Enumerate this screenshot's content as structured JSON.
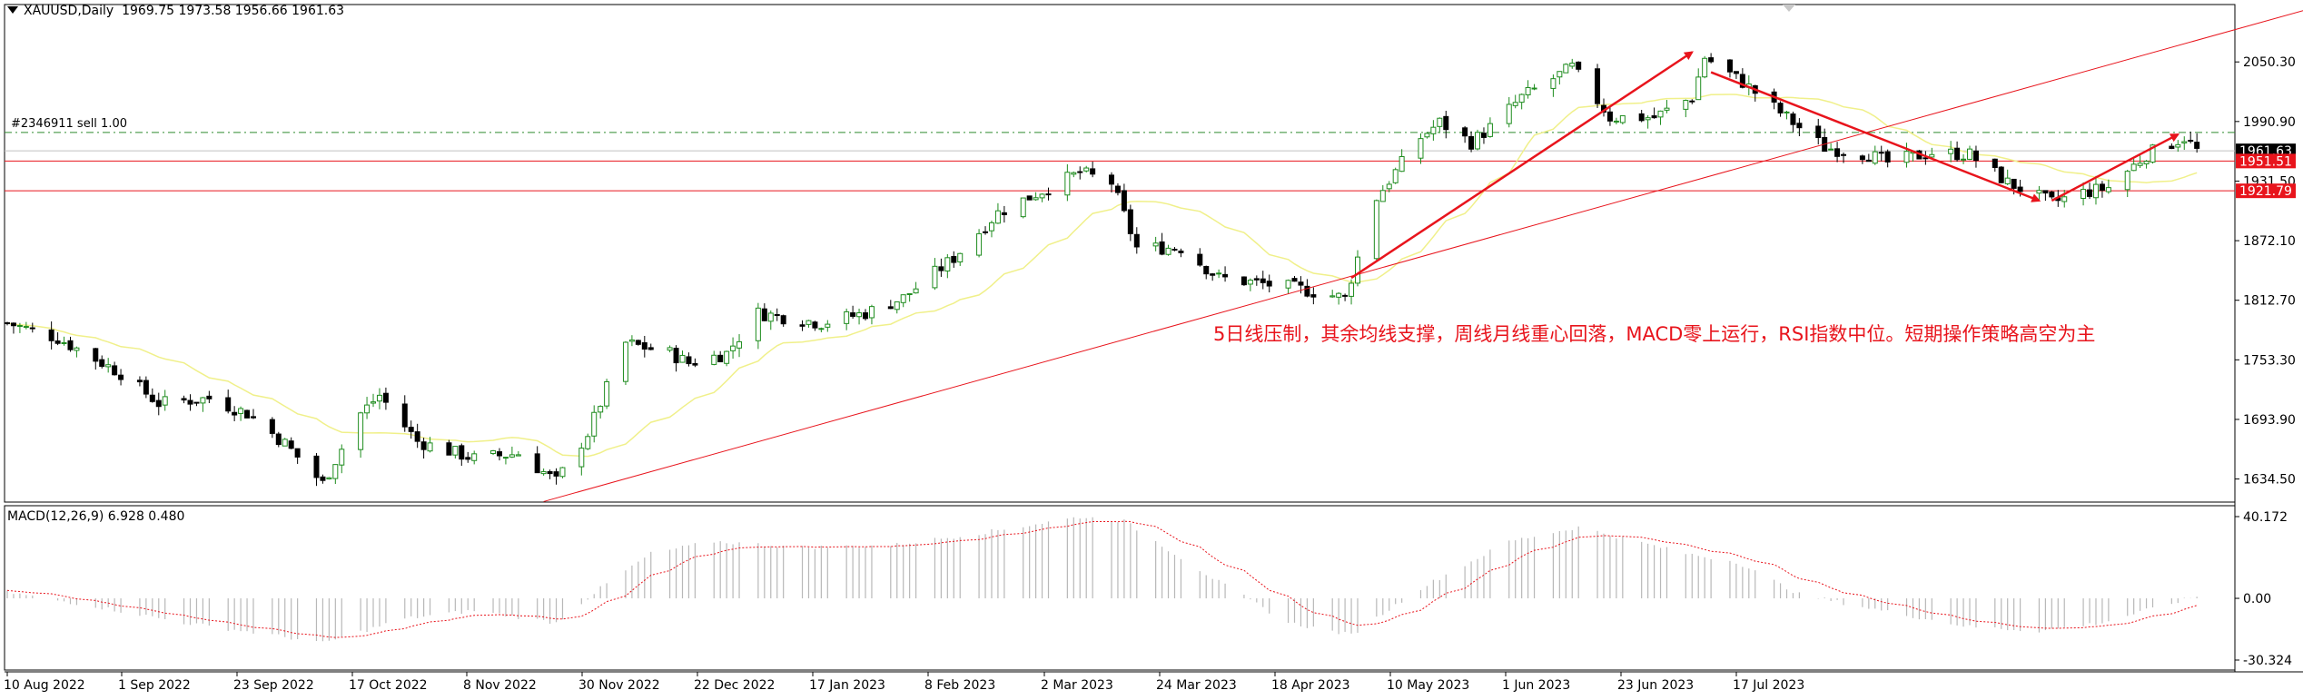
{
  "header": {
    "symbol": "XAUUSD,Daily",
    "ohlc": "1969.75 1973.58 1956.66 1961.63"
  },
  "order_line": {
    "label": "#2346911 sell 1.00",
    "price": 1980.0
  },
  "annotation": "5日线压制，其余均线支撑，周线月线重心回落，MACD零上运行，RSI指数中位。短期操作策略高空为主",
  "price_axis": {
    "ticks": [
      "2050.30",
      "1990.90",
      "1931.50",
      "1872.10",
      "1812.70",
      "1753.30",
      "1693.90",
      "1634.50"
    ],
    "current_price": {
      "label": "1961.63",
      "value": 1961.63
    },
    "levels": [
      {
        "label": "1951.51",
        "value": 1951.51
      },
      {
        "label": "1921.79",
        "value": 1921.79
      }
    ]
  },
  "macd": {
    "label": "MACD(12,26,9) 6.928 0.480",
    "ticks": [
      "40.172",
      "0.00",
      "-30.324"
    ]
  },
  "date_axis": {
    "labels": [
      "10 Aug 2022",
      "1 Sep 2022",
      "23 Sep 2022",
      "17 Oct 2022",
      "8 Nov 2022",
      "30 Nov 2022",
      "22 Dec 2022",
      "17 Jan 2023",
      "8 Feb 2023",
      "2 Mar 2023",
      "24 Mar 2023",
      "18 Apr 2023",
      "10 May 2023",
      "1 Jun 2023",
      "23 Jun 2023",
      "17 Jul 2023"
    ]
  },
  "colors": {
    "bull": "#1e8c1e",
    "bear": "#000000",
    "ma": "#f0f08a",
    "annotation": "#e8141c",
    "level": "#e8141c",
    "trendline": "#e8141c",
    "order_line": "#2e8b2e",
    "macd_signal": "#e8141c",
    "macd_hist": "#b8b8b8"
  },
  "chart_data": [
    {
      "type": "candlestick",
      "title": "XAUUSD,Daily",
      "ylim": [
        1611.5,
        2107.5
      ],
      "keypoints": [
        {
          "x": "2022-08-08",
          "y": 1790
        },
        {
          "x": "2022-08-16",
          "y": 1775
        },
        {
          "x": "2022-08-26",
          "y": 1740
        },
        {
          "x": "2022-09-01",
          "y": 1710
        },
        {
          "x": "2022-09-09",
          "y": 1715
        },
        {
          "x": "2022-09-15",
          "y": 1700
        },
        {
          "x": "2022-09-21",
          "y": 1670
        },
        {
          "x": "2022-09-27",
          "y": 1630
        },
        {
          "x": "2022-10-03",
          "y": 1700
        },
        {
          "x": "2022-10-06",
          "y": 1718
        },
        {
          "x": "2022-10-12",
          "y": 1672
        },
        {
          "x": "2022-10-21",
          "y": 1655
        },
        {
          "x": "2022-10-28",
          "y": 1660
        },
        {
          "x": "2022-11-03",
          "y": 1632
        },
        {
          "x": "2022-11-08",
          "y": 1680
        },
        {
          "x": "2022-11-14",
          "y": 1770
        },
        {
          "x": "2022-11-21",
          "y": 1760
        },
        {
          "x": "2022-11-24",
          "y": 1750
        },
        {
          "x": "2022-11-30",
          "y": 1760
        },
        {
          "x": "2022-12-05",
          "y": 1800
        },
        {
          "x": "2022-12-15",
          "y": 1790
        },
        {
          "x": "2022-12-22",
          "y": 1800
        },
        {
          "x": "2022-12-28",
          "y": 1815
        },
        {
          "x": "2023-01-05",
          "y": 1855
        },
        {
          "x": "2023-01-12",
          "y": 1900
        },
        {
          "x": "2023-01-20",
          "y": 1925
        },
        {
          "x": "2023-01-25",
          "y": 1940
        },
        {
          "x": "2023-01-30",
          "y": 1930
        },
        {
          "x": "2023-02-03",
          "y": 1865
        },
        {
          "x": "2023-02-10",
          "y": 1865
        },
        {
          "x": "2023-02-16",
          "y": 1835
        },
        {
          "x": "2023-02-22",
          "y": 1830
        },
        {
          "x": "2023-02-28",
          "y": 1825
        },
        {
          "x": "2023-03-08",
          "y": 1815
        },
        {
          "x": "2023-03-13",
          "y": 1915
        },
        {
          "x": "2023-03-20",
          "y": 1975
        },
        {
          "x": "2023-03-23",
          "y": 1990
        },
        {
          "x": "2023-03-28",
          "y": 1970
        },
        {
          "x": "2023-03-31",
          "y": 1985
        },
        {
          "x": "2023-04-05",
          "y": 2015
        },
        {
          "x": "2023-04-13",
          "y": 2045
        },
        {
          "x": "2023-04-19",
          "y": 1995
        },
        {
          "x": "2023-04-26",
          "y": 1995
        },
        {
          "x": "2023-05-02",
          "y": 2015
        },
        {
          "x": "2023-05-04",
          "y": 2055
        },
        {
          "x": "2023-05-10",
          "y": 2030
        },
        {
          "x": "2023-05-16",
          "y": 2000
        },
        {
          "x": "2023-05-23",
          "y": 1965
        },
        {
          "x": "2023-05-30",
          "y": 1958
        },
        {
          "x": "2023-06-02",
          "y": 1950
        },
        {
          "x": "2023-06-09",
          "y": 1960
        },
        {
          "x": "2023-06-15",
          "y": 1958
        },
        {
          "x": "2023-06-21",
          "y": 1930
        },
        {
          "x": "2023-06-28",
          "y": 1910
        },
        {
          "x": "2023-07-03",
          "y": 1920
        },
        {
          "x": "2023-07-07",
          "y": 1925
        },
        {
          "x": "2023-07-13",
          "y": 1958
        },
        {
          "x": "2023-07-19",
          "y": 1975
        },
        {
          "x": "2023-07-21",
          "y": 1962
        }
      ]
    },
    {
      "type": "bar",
      "title": "MACD(12,26,9) 6.928 0.480",
      "ylim": [
        -30.324,
        40.172
      ],
      "keypoints": [
        {
          "x": "2022-08-08",
          "y": 3
        },
        {
          "x": "2022-08-22",
          "y": -4
        },
        {
          "x": "2022-09-05",
          "y": -12
        },
        {
          "x": "2022-09-19",
          "y": -18
        },
        {
          "x": "2022-09-27",
          "y": -22
        },
        {
          "x": "2022-10-10",
          "y": -10
        },
        {
          "x": "2022-10-21",
          "y": -6
        },
        {
          "x": "2022-11-03",
          "y": -12
        },
        {
          "x": "2022-11-10",
          "y": 5
        },
        {
          "x": "2022-11-18",
          "y": 22
        },
        {
          "x": "2022-11-28",
          "y": 28
        },
        {
          "x": "2022-12-12",
          "y": 25
        },
        {
          "x": "2022-12-26",
          "y": 26
        },
        {
          "x": "2023-01-09",
          "y": 32
        },
        {
          "x": "2023-01-25",
          "y": 40
        },
        {
          "x": "2023-02-01",
          "y": 38
        },
        {
          "x": "2023-02-15",
          "y": 10
        },
        {
          "x": "2023-02-27",
          "y": -12
        },
        {
          "x": "2023-03-09",
          "y": -18
        },
        {
          "x": "2023-03-20",
          "y": 5
        },
        {
          "x": "2023-04-03",
          "y": 28
        },
        {
          "x": "2023-04-14",
          "y": 35
        },
        {
          "x": "2023-05-01",
          "y": 22
        },
        {
          "x": "2023-05-09",
          "y": 18
        },
        {
          "x": "2023-05-19",
          "y": 2
        },
        {
          "x": "2023-06-01",
          "y": -6
        },
        {
          "x": "2023-06-15",
          "y": -14
        },
        {
          "x": "2023-06-26",
          "y": -16
        },
        {
          "x": "2023-07-06",
          "y": -12
        },
        {
          "x": "2023-07-21",
          "y": 1
        }
      ]
    }
  ]
}
